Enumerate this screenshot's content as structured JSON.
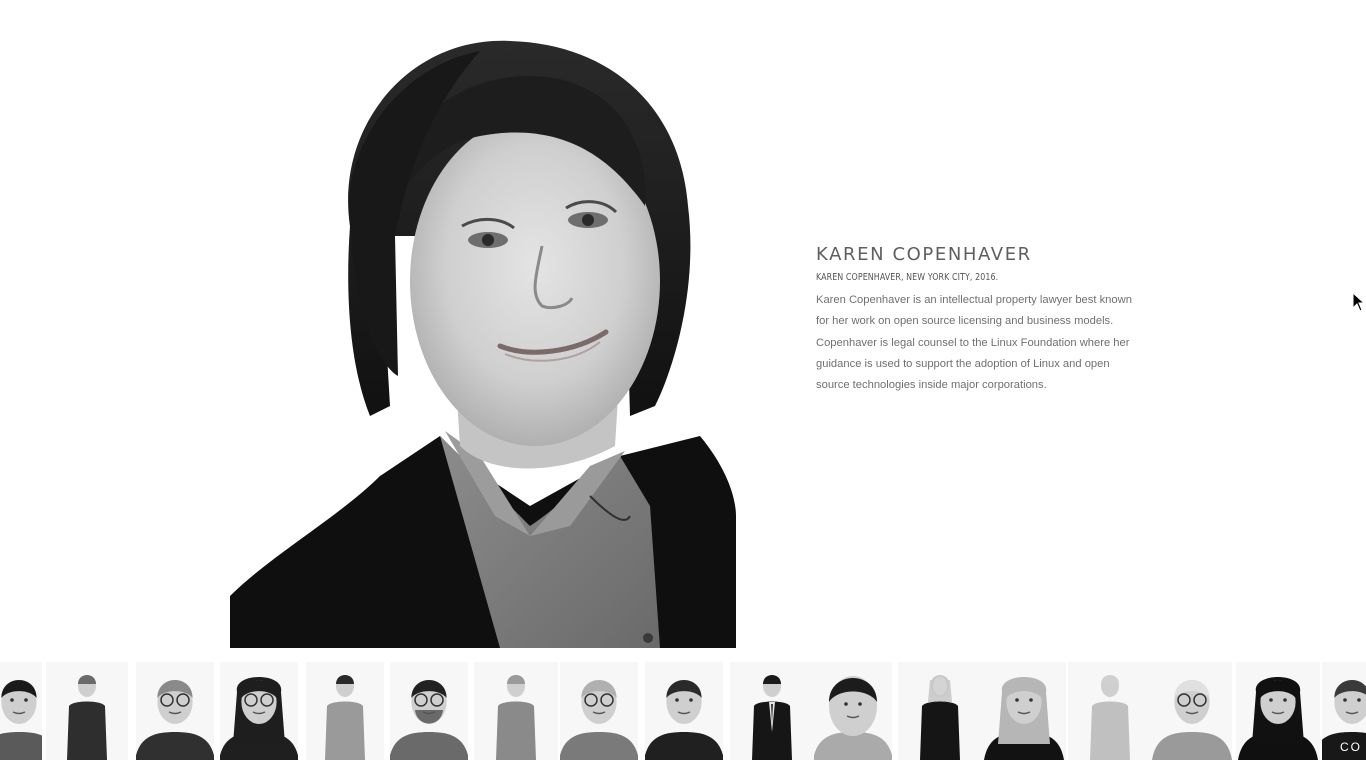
{
  "profile": {
    "name": "KAREN COPENHAVER",
    "caption": "KAREN COPENHAVER, NEW YORK CITY, 2016.",
    "bio": "Karen Copenhaver is an intellectual property lawyer best known for her work on open source licensing and business models. Copenhaver is legal counsel to the Linux Foundation where her guidance is used to support the adoption of Linux and open source technologies inside major corporations."
  },
  "thumbnails": [
    {
      "pose": "headshot",
      "hair": "#1a1a1a",
      "top": "#5a5a5a"
    },
    {
      "pose": "full",
      "hair": "#6a6a6a",
      "top": "#2e2e2e"
    },
    {
      "pose": "headshot-glasses",
      "hair": "#8a8a8a",
      "top": "#303030"
    },
    {
      "pose": "long-hair-glasses",
      "hair": "#1e1e1e",
      "top": "#1f1f1f"
    },
    {
      "pose": "full",
      "hair": "#2a2a2a",
      "top": "#9a9a9a"
    },
    {
      "pose": "headshot-glasses-beard",
      "hair": "#222222",
      "top": "#6a6a6a"
    },
    {
      "pose": "full",
      "hair": "#9a9a9a",
      "top": "#8a8a8a"
    },
    {
      "pose": "headshot-glasses",
      "hair": "#b0b0b0",
      "top": "#7a7a7a"
    },
    {
      "pose": "headshot",
      "hair": "#2a2a2a",
      "top": "#202020"
    },
    {
      "pose": "suit",
      "hair": "#1a1a1a",
      "top": "#161616"
    },
    {
      "pose": "headshot-close",
      "hair": "#1c1c1c",
      "top": "#aaaaaa"
    },
    {
      "pose": "full-blonde",
      "hair": "#c8c8c8",
      "top": "#151515"
    },
    {
      "pose": "long-hair",
      "hair": "#b6b6b6",
      "top": "#121212"
    },
    {
      "pose": "full",
      "hair": "#d0d0d0",
      "top": "#c0c0c0"
    },
    {
      "pose": "headshot-glasses",
      "hair": "#e0e0e0",
      "top": "#9a9a9a"
    },
    {
      "pose": "long-hair",
      "hair": "#111111",
      "top": "#101010"
    },
    {
      "pose": "partial",
      "hair": "#3a3a3a",
      "top": "#181818"
    }
  ],
  "strip_partial_text": "CO"
}
